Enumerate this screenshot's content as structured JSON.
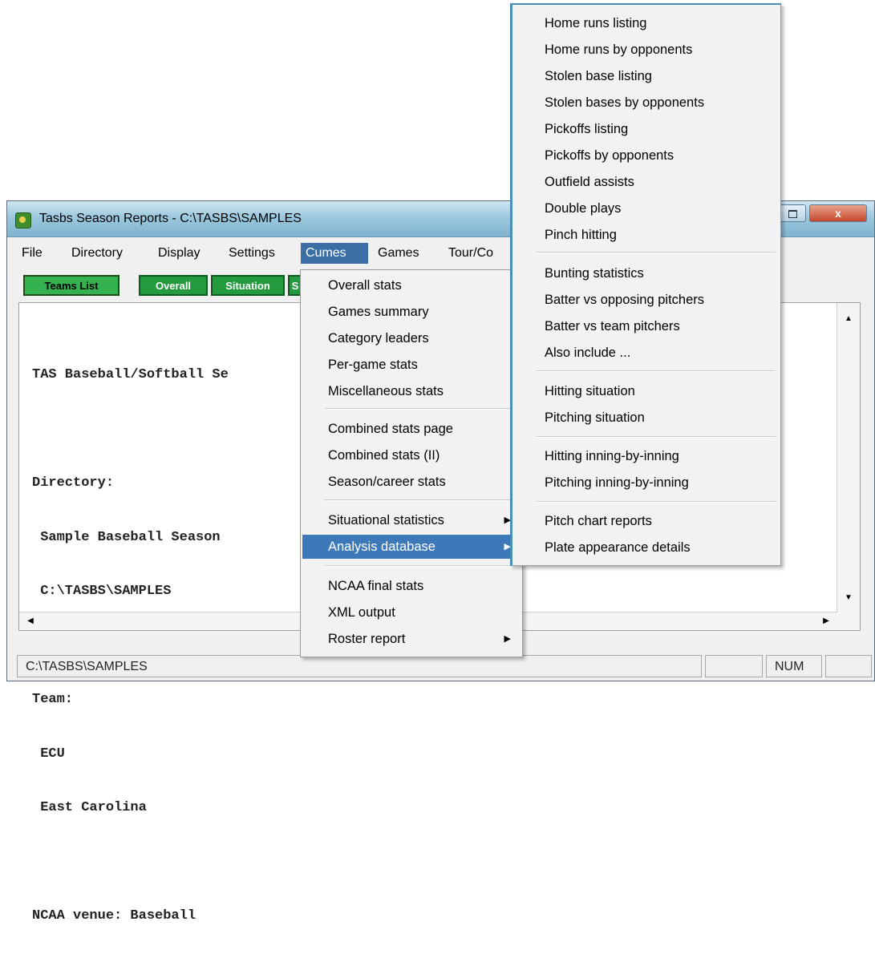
{
  "window": {
    "title": "Tasbs Season Reports - C:\\TASBS\\SAMPLES",
    "close_label": "x"
  },
  "menubar": {
    "items": [
      "File",
      "Directory",
      "Display",
      "Settings",
      "Cumes",
      "Games",
      "Tour/Co"
    ]
  },
  "toolbar": {
    "buttons": [
      "Teams List",
      "Overall",
      "Situation",
      "S"
    ]
  },
  "report": {
    "lines": [
      "TAS Baseball/Softball Se",
      "",
      "Directory:",
      " Sample Baseball Season",
      " C:\\TASBS\\SAMPLES",
      "",
      "Team:",
      " ECU",
      " East Carolina",
      "",
      "NCAA venue: Baseball"
    ]
  },
  "status_bar": {
    "path": "C:\\TASBS\\SAMPLES",
    "num": "NUM"
  },
  "cumes_menu": {
    "items": [
      "Overall stats",
      "Games summary",
      "Category leaders",
      "Per-game stats",
      "Miscellaneous stats",
      "Combined stats page",
      "Combined stats (II)",
      "Season/career stats",
      "Situational statistics",
      "Analysis database",
      "NCAA final stats",
      "XML output",
      "Roster report"
    ],
    "highlighted": "Analysis database"
  },
  "analysis_menu": {
    "items": [
      "Home runs listing",
      "Home runs by opponents",
      "Stolen base listing",
      "Stolen bases by opponents",
      "Pickoffs listing",
      "Pickoffs by opponents",
      "Outfield assists",
      "Double plays",
      "Pinch hitting",
      "Bunting statistics",
      "Batter vs opposing pitchers",
      "Batter vs team pitchers",
      "Also include ...",
      "Hitting situation",
      "Pitching situation",
      "Hitting inning-by-inning",
      "Pitching inning-by-inning",
      "Pitch chart reports",
      "Plate appearance details"
    ]
  },
  "icons": {
    "app": "baseball-app-icon",
    "submenu": "chevron-right-icon",
    "scroll_up": "arrow-up-icon",
    "scroll_down": "arrow-down-icon",
    "scroll_left": "arrow-left-icon",
    "scroll_right": "arrow-right-icon"
  },
  "colors": {
    "highlight": "#3d78b8",
    "toolbar_green": "#249a3e"
  }
}
